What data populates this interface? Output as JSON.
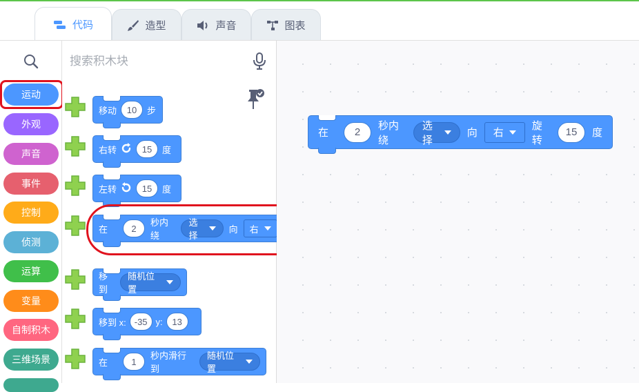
{
  "tabs": [
    {
      "label": "代码",
      "icon": "code-icon",
      "active": true
    },
    {
      "label": "造型",
      "icon": "brush-icon",
      "active": false
    },
    {
      "label": "声音",
      "icon": "speaker-icon",
      "active": false
    },
    {
      "label": "图表",
      "icon": "diagram-icon",
      "active": false
    }
  ],
  "search": {
    "placeholder": "搜索积木块"
  },
  "categories": [
    {
      "label": "运动",
      "color": "#4c97ff",
      "selected": true
    },
    {
      "label": "外观",
      "color": "#9966ff"
    },
    {
      "label": "声音",
      "color": "#cf63cf"
    },
    {
      "label": "事件",
      "color": "#e6606e"
    },
    {
      "label": "控制",
      "color": "#ffab19"
    },
    {
      "label": "侦测",
      "color": "#5cb1d6"
    },
    {
      "label": "运算",
      "color": "#40bf4a"
    },
    {
      "label": "变量",
      "color": "#ff8c1a"
    },
    {
      "label": "自制积木",
      "color": "#ff6680"
    },
    {
      "label": "三维场景",
      "color": "#3ea98f"
    }
  ],
  "blocks": {
    "move": {
      "label": "移动",
      "value": "10",
      "suffix": "步"
    },
    "turn_right": {
      "label": "右转",
      "value": "15",
      "suffix": "度"
    },
    "turn_left": {
      "label": "左转",
      "value": "15",
      "suffix": "度"
    },
    "rotate": {
      "prefix": "在",
      "seconds": "2",
      "mid": "秒内绕",
      "target": "选择",
      "dir_label": "向",
      "direction": "右",
      "turn_label": "旋转",
      "degrees": "15",
      "suffix": "度"
    },
    "goto": {
      "label": "移到",
      "target": "随机位置"
    },
    "goto_xy": {
      "label": "移到 x:",
      "x": "-35",
      "ylabel": "y:",
      "y": "13"
    },
    "glide": {
      "prefix": "在",
      "seconds": "1",
      "mid": "秒内滑行到",
      "target": "随机位置"
    }
  },
  "workspace_block": {
    "prefix": "在",
    "seconds": "2",
    "mid": "秒内绕",
    "target": "选择",
    "dir_label": "向",
    "direction": "右",
    "turn_label": "旋转",
    "degrees": "15",
    "suffix": "度"
  }
}
